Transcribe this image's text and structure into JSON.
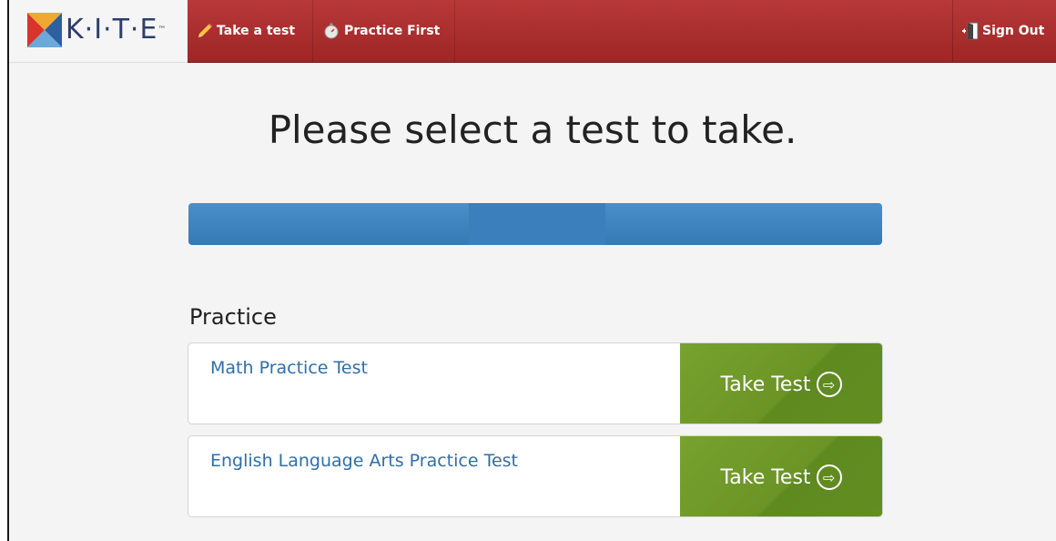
{
  "header": {
    "logo_text": "K·I·T·E",
    "logo_tm": "™",
    "nav": {
      "take_test": "Take a test",
      "practice_first": "Practice First",
      "sign_out": "Sign Out"
    }
  },
  "main": {
    "title": "Please select a test to take.",
    "section_label": "Practice",
    "tests": [
      {
        "name": "Math Practice Test",
        "button_label": "Take Test"
      },
      {
        "name": "English Language Arts Practice Test",
        "button_label": "Take Test"
      }
    ]
  },
  "colors": {
    "header_red": "#a82c2c",
    "tab_blue": "#3f84c0",
    "button_green": "#6b9426",
    "link_blue": "#2f6ea8"
  },
  "icons": {
    "take_test": "pencil-icon",
    "practice_first": "stopwatch-icon",
    "sign_out": "door-exit-icon",
    "button_arrow": "arrow-circle-right-icon"
  }
}
